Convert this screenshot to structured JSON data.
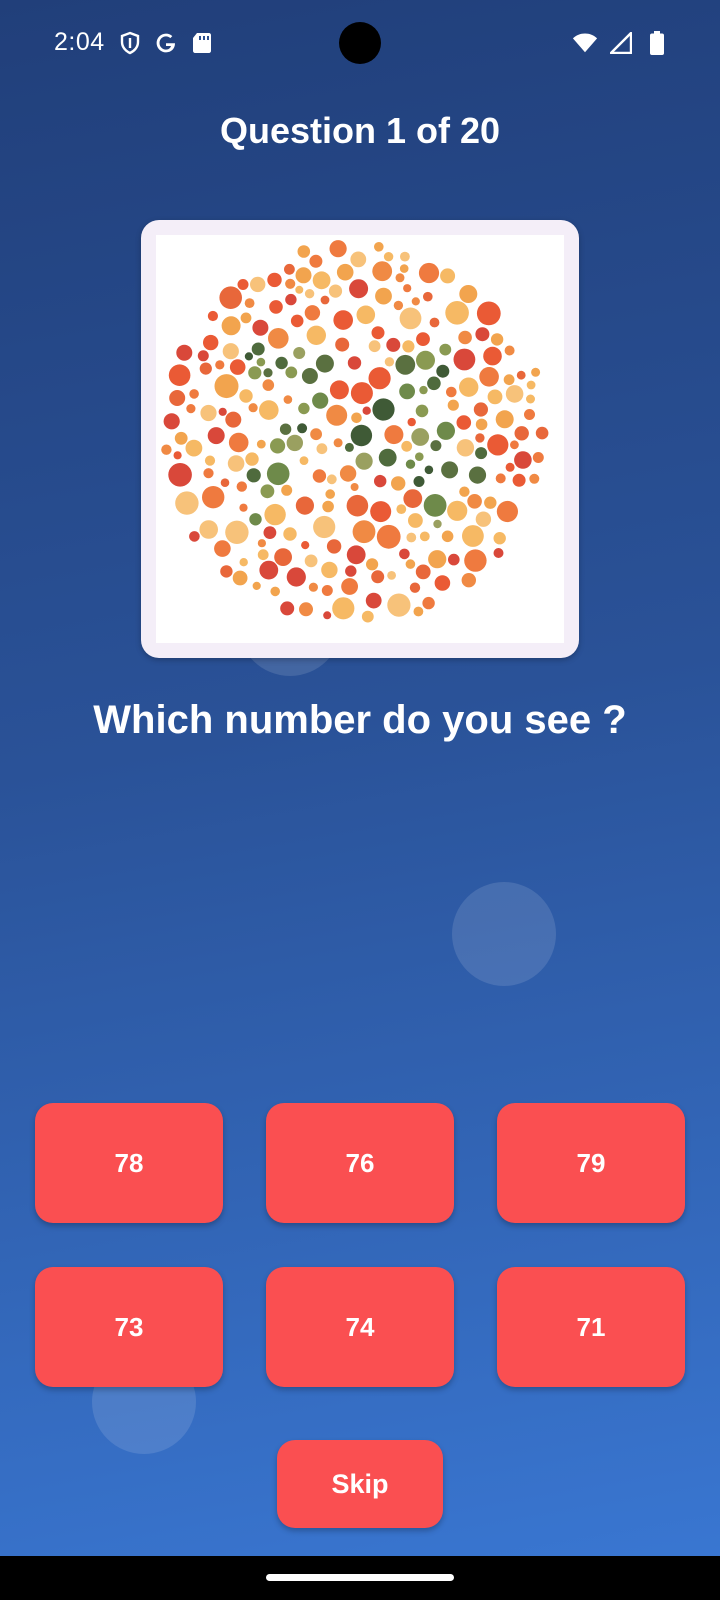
{
  "status_bar": {
    "time": "2:04",
    "icons": [
      "shield-icon",
      "google-icon",
      "sd-card-icon",
      "wifi-icon",
      "signal-icon",
      "battery-icon"
    ]
  },
  "quiz": {
    "title": "Question 1 of 20",
    "prompt": "Which number do you see ?",
    "plate_image": "ishihara-color-plate"
  },
  "answers": {
    "row1": [
      "78",
      "76",
      "79"
    ],
    "row2": [
      "73",
      "74",
      "71"
    ]
  },
  "skip_label": "Skip",
  "colors": {
    "background_top": "#213f7a",
    "background_bottom": "#3a78d4",
    "button": "#fa4f51",
    "card": "#f4eef8"
  }
}
